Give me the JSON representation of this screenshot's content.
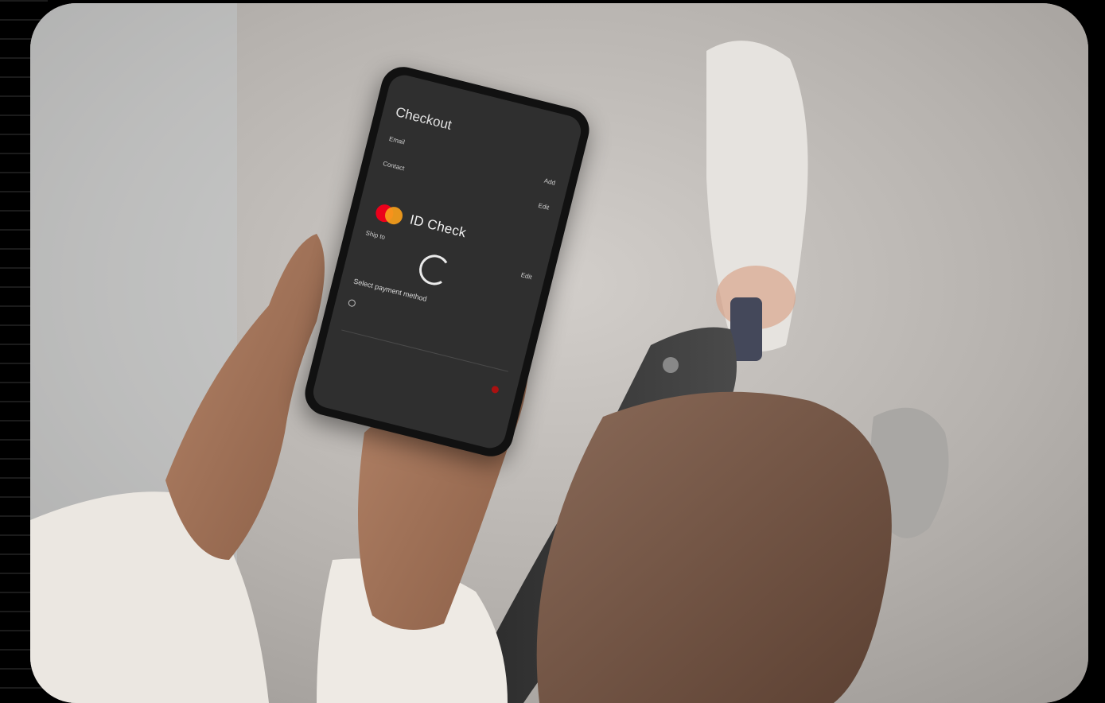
{
  "scene": {
    "subject": "person holding smartphone showing checkout",
    "accent_colors": {
      "mastercard_red": "#eb001b",
      "mastercard_orange": "#f79e1b",
      "phone_screen": "#2f2f2f"
    }
  },
  "phone": {
    "screen_title": "Checkout",
    "overlay_text": "ID Check",
    "rows": [
      {
        "label": "Email",
        "sub": "",
        "action": "Add"
      },
      {
        "label": "Contact",
        "sub": "",
        "action": "Edit"
      },
      {
        "label": "Ship to",
        "sub": "",
        "action": "Edit"
      }
    ],
    "payment_header": "Select payment method",
    "payment_option": "",
    "card_number": "",
    "footer_left": "",
    "footer_right": ""
  },
  "icons": {
    "logo": "mastercard-logo",
    "spinner": "loading-spinner-icon"
  }
}
